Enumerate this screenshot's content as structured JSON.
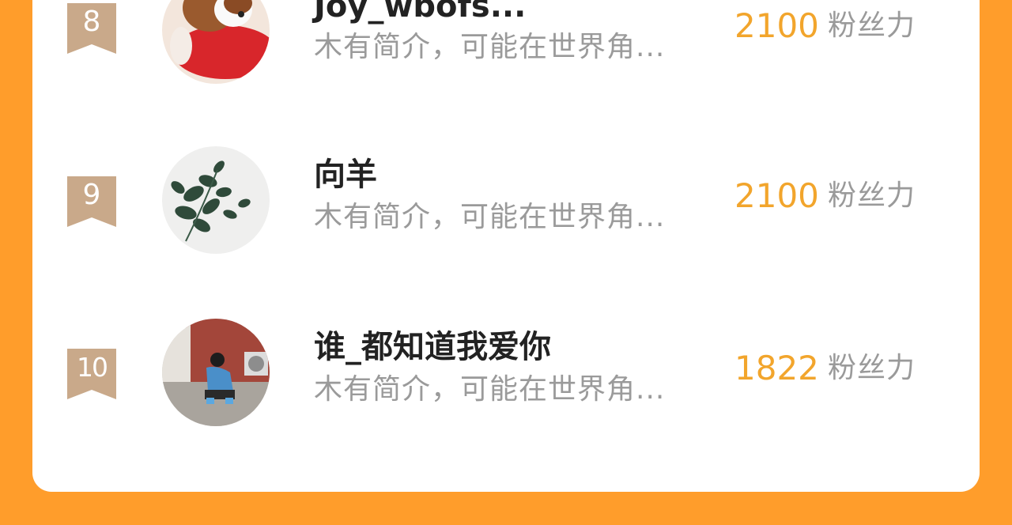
{
  "colors": {
    "background": "#FF9D2B",
    "card": "#FFFFFF",
    "fans_count": "#F2A52C",
    "badge": "#C9A98A"
  },
  "rows": [
    {
      "rank": "8",
      "name": "Joy_wbofs...",
      "bio": "木有简介，可能在世界角...",
      "fans_count": "2100",
      "fans_label": "粉丝力",
      "avatar_icon": "dog-on-red-pillow-avatar"
    },
    {
      "rank": "9",
      "name": "向羊",
      "bio": "木有简介，可能在世界角...",
      "fans_count": "2100",
      "fans_label": "粉丝力",
      "avatar_icon": "plant-leaves-avatar"
    },
    {
      "rank": "10",
      "name": "谁_都知道我爱你",
      "bio": "木有简介，可能在世界角...",
      "fans_count": "1822",
      "fans_label": "粉丝力",
      "avatar_icon": "person-crouching-avatar"
    }
  ]
}
